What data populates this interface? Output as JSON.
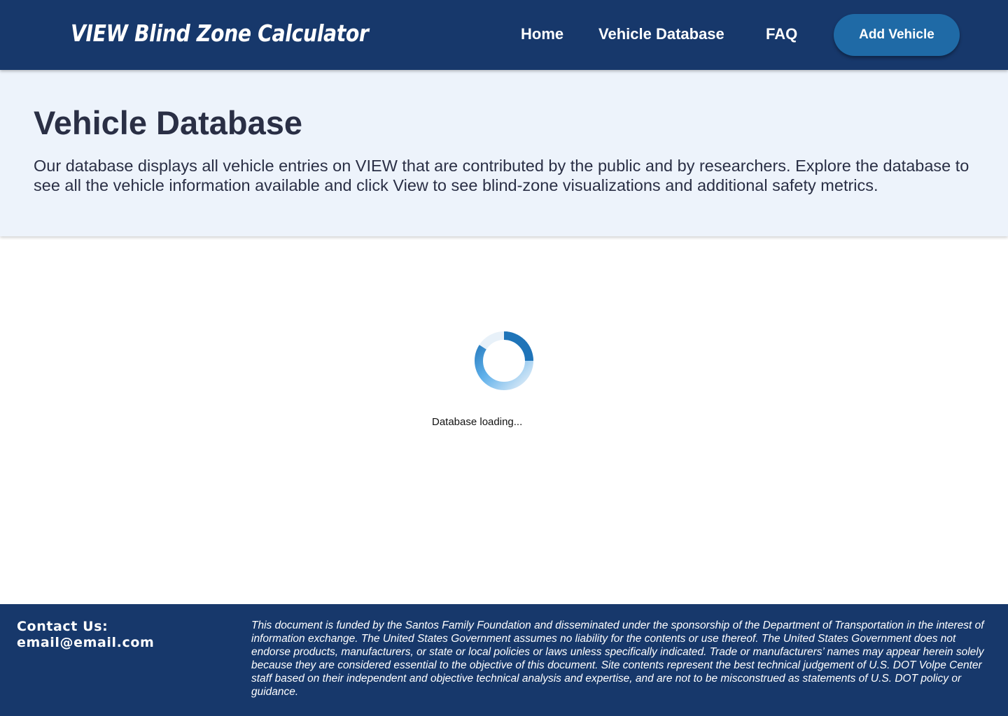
{
  "header": {
    "brand": "VIEW Blind Zone Calculator",
    "nav": {
      "home": "Home",
      "vehicle_database": "Vehicle Database",
      "faq": "FAQ"
    },
    "add_vehicle_label": "Add Vehicle"
  },
  "hero": {
    "title": "Vehicle Database",
    "description": "Our database displays all vehicle entries on VIEW that are contributed by the public and by researchers. Explore the database to see all the vehicle information available and click View to see blind-zone visualizations and additional safety metrics."
  },
  "loader": {
    "icon": "spinner-icon",
    "text": "Database loading..."
  },
  "footer": {
    "contact_label": "Contact Us:",
    "contact_email": "email@email.com",
    "disclaimer": "This document is funded by the Santos Family Foundation and disseminated under the sponsorship of the Department of Transportation in the interest of information exchange. The United States Government assumes no liability for the contents or use thereof. The United States Government does not endorse products, manufacturers, or state or local policies or laws unless specifically indicated. Trade or manufacturers’ names may appear herein solely because they are considered essential to the objective of this document. Site contents represent the best technical judgement of U.S. DOT Volpe Center staff based on their independent and objective technical analysis and expertise, and are not to be misconstrued as statements of U.S. DOT policy or guidance."
  },
  "colors": {
    "header_bg": "#17386b",
    "button_bg": "#1f6aa6",
    "hero_bg": "#edf3fb",
    "spinner_dark": "#1f74b8",
    "spinner_light": "#e3eef8"
  }
}
